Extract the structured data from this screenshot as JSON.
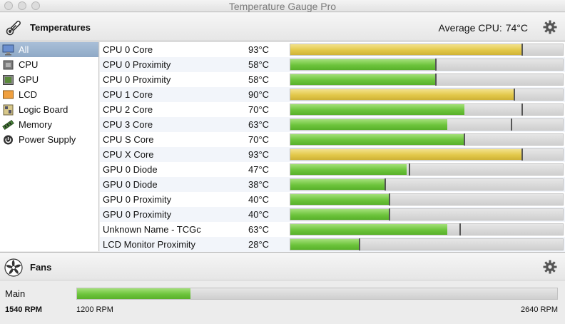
{
  "window": {
    "title": "Temperature Gauge Pro"
  },
  "temperatures": {
    "section_title": "Temperatures",
    "average_label": "Average CPU:",
    "average_value": "74°C"
  },
  "sidebar": {
    "items": [
      {
        "label": "All",
        "icon": "all-sensors-icon",
        "selected": true
      },
      {
        "label": "CPU",
        "icon": "cpu-icon"
      },
      {
        "label": "GPU",
        "icon": "gpu-icon"
      },
      {
        "label": "LCD",
        "icon": "lcd-icon"
      },
      {
        "label": "Logic Board",
        "icon": "logic-board-icon"
      },
      {
        "label": "Memory",
        "icon": "memory-icon"
      },
      {
        "label": "Power Supply",
        "icon": "power-supply-icon"
      }
    ]
  },
  "sensors": [
    {
      "name": "CPU 0 Core",
      "temp": "93°C",
      "level": 0.85,
      "max": 0.85,
      "color": "yellow"
    },
    {
      "name": "CPU 0 Proximity",
      "temp": "58°C",
      "level": 0.535,
      "max": 0.535,
      "color": "green"
    },
    {
      "name": "CPU 0 Proximity",
      "temp": "58°C",
      "level": 0.535,
      "max": 0.535,
      "color": "green"
    },
    {
      "name": "CPU 1 Core",
      "temp": "90°C",
      "level": 0.822,
      "max": 0.822,
      "color": "yellow"
    },
    {
      "name": "CPU 2 Core",
      "temp": "70°C",
      "level": 0.64,
      "max": 0.85,
      "color": "green"
    },
    {
      "name": "CPU 3 Core",
      "temp": "63°C",
      "level": 0.575,
      "max": 0.812,
      "color": "green"
    },
    {
      "name": "CPU S Core",
      "temp": "70°C",
      "level": 0.64,
      "max": 0.64,
      "color": "green"
    },
    {
      "name": "CPU X Core",
      "temp": "93°C",
      "level": 0.852,
      "max": 0.852,
      "color": "yellow"
    },
    {
      "name": "GPU 0 Diode",
      "temp": "47°C",
      "level": 0.428,
      "max": 0.438,
      "color": "green"
    },
    {
      "name": "GPU 0 Diode",
      "temp": "38°C",
      "level": 0.348,
      "max": 0.348,
      "color": "green"
    },
    {
      "name": "GPU 0 Proximity",
      "temp": "40°C",
      "level": 0.365,
      "max": 0.365,
      "color": "green"
    },
    {
      "name": "GPU 0 Proximity",
      "temp": "40°C",
      "level": 0.365,
      "max": 0.365,
      "color": "green"
    },
    {
      "name": "Unknown Name - TCGc",
      "temp": "63°C",
      "level": 0.575,
      "max": 0.622,
      "color": "green"
    },
    {
      "name": "LCD Monitor Proximity",
      "temp": "28°C",
      "level": 0.255,
      "max": 0.255,
      "color": "green"
    }
  ],
  "fans": {
    "section_title": "Fans",
    "items": [
      {
        "name": "Main",
        "rpm": "1540 RPM",
        "min": "1200 RPM",
        "max": "2640 RPM",
        "level": 0.236
      }
    ]
  }
}
